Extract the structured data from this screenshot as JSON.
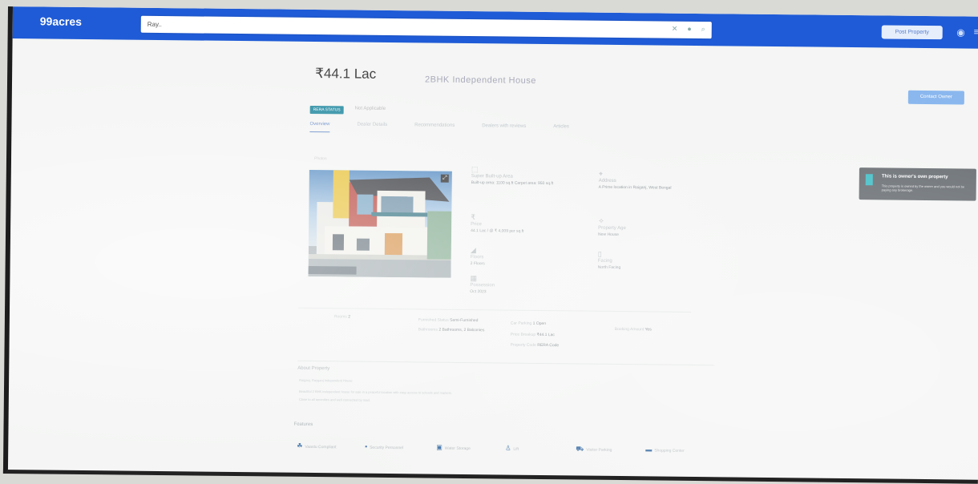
{
  "header": {
    "logo": "99acres",
    "search_value": "Ray..",
    "search_icons": [
      "close-icon",
      "mic-icon",
      "search-icon"
    ],
    "post_button": "Post Property",
    "user_icon": "user-icon",
    "menu_icon": "menu-icon"
  },
  "listing": {
    "price": "₹44.1 Lac",
    "summary": "2BHK Independent House",
    "contact_button": "Contact Owner",
    "badge": "RERA STATUS",
    "badge_note": "Not Applicable"
  },
  "tabs": [
    "Overview",
    "Dealer Details",
    "Recommendations",
    "Dealers with reviews",
    "Articles"
  ],
  "photos_label": "Photos",
  "details": {
    "col1": [
      {
        "icon": "area-icon",
        "label": "Super Built-up Area",
        "value": "Built-up area: 1100 sq.ft Carpet area: 950 sq.ft"
      },
      {
        "icon": "price-icon",
        "label": "Price",
        "value": "44.1 Lac / @ ₹ 4,009 per sq.ft"
      },
      {
        "icon": "floor-icon",
        "label": "Floors",
        "value": "2 Floors"
      },
      {
        "icon": "calendar-icon",
        "label": "Possession",
        "value": "Oct 2023"
      }
    ],
    "col2": [
      {
        "icon": "location-icon",
        "label": "Address",
        "value": "A Prime location in Raiganj, West Bengal"
      },
      {
        "icon": "age-icon",
        "label": "Property Age",
        "value": "New House"
      },
      {
        "icon": "door-icon",
        "label": "Facing",
        "value": "North Facing"
      }
    ]
  },
  "owner_card": {
    "title": "This is owner's own property",
    "desc": "This property is owned by the owner and you would not be paying any brokerage."
  },
  "info_rows": [
    {
      "label": "Rooms",
      "value": "2"
    },
    {
      "label": "Furnished Status",
      "value": "Semi-Furnished"
    },
    {
      "label": "Bathrooms",
      "value": "2 Bathrooms, 2 Balconies"
    },
    {
      "label": "Car Parking",
      "value": "1 Open"
    },
    {
      "label": "Price Breakup",
      "value": "₹44.1 Lac"
    },
    {
      "label": "Booking Amount",
      "value": "Yes"
    },
    {
      "label": "Property Code",
      "value": "RERA Code"
    }
  ],
  "about": {
    "title": "About Property",
    "line1": "Raiganj, Rayganj Independent House",
    "line2": "Beautiful 2 BHK independent house for sale in a peaceful location with easy access to schools and markets.",
    "line3": "Close to all amenities and well connected by road."
  },
  "features_title": "Features",
  "features": [
    {
      "icon": "park-icon",
      "label": "Vaastu Compliant"
    },
    {
      "icon": "security-icon",
      "label": "Security Personnel"
    },
    {
      "icon": "water-icon",
      "label": "Water Storage"
    },
    {
      "icon": "lift-icon",
      "label": "Lift"
    },
    {
      "icon": "parking-icon",
      "label": "Visitor Parking"
    },
    {
      "icon": "shopping-icon",
      "label": "Shopping Center"
    }
  ]
}
